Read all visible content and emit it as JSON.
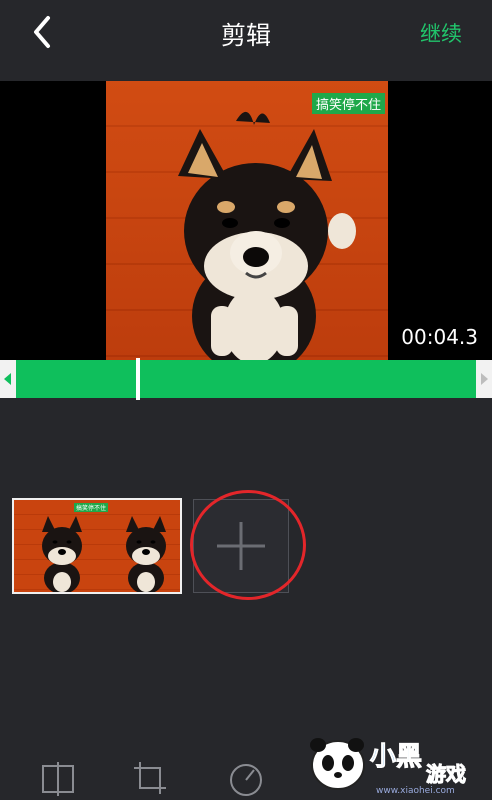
{
  "header": {
    "title": "剪辑",
    "continue_label": "继续"
  },
  "video": {
    "overlay_text": "搞笑停不住",
    "timecode": "00:04.3"
  },
  "timeline": {
    "clip_overlay_text": "搞笑停不住"
  },
  "toolbar": {
    "icons": [
      "split-icon",
      "crop-icon",
      "speed-icon"
    ]
  },
  "watermark": {
    "logo_text": "小黑游戏",
    "site_text": "www.xiaohei.com"
  },
  "colors": {
    "accent": "#21c46b",
    "trim_bar": "#0fbf5c",
    "highlight_circle": "#e3262a",
    "background": "#26272b"
  }
}
